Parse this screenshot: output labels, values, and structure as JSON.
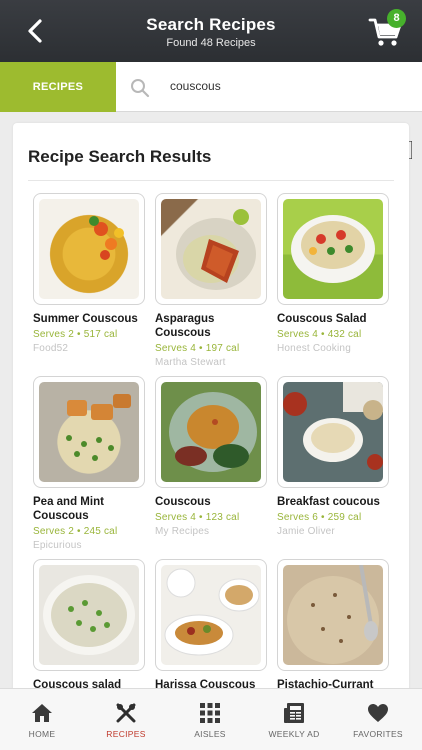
{
  "header": {
    "title": "Search Recipes",
    "subtitle": "Found 48 Recipes",
    "cart_count": "8"
  },
  "search": {
    "tab_label": "RECIPES",
    "query": "couscous"
  },
  "results": {
    "heading": "Recipe Search Results",
    "items": [
      {
        "name": "Summer Couscous",
        "meta": "Serves 2 • 517 cal",
        "source": "Food52"
      },
      {
        "name": "Asparagus Couscous",
        "meta": "Serves 4 • 197 cal",
        "source": "Martha Stewart"
      },
      {
        "name": "Couscous Salad",
        "meta": "Serves 4 • 432 cal",
        "source": "Honest Cooking"
      },
      {
        "name": "Pea and Mint Couscous",
        "meta": "Serves 2 • 245 cal",
        "source": "Epicurious"
      },
      {
        "name": "Couscous",
        "meta": "Serves 4 • 123 cal",
        "source": "My Recipes"
      },
      {
        "name": "Breakfast coucous",
        "meta": "Serves 6 • 259 cal",
        "source": "Jamie Oliver"
      },
      {
        "name": "Couscous salad",
        "meta": "",
        "source": ""
      },
      {
        "name": "Harissa Couscous",
        "meta": "",
        "source": ""
      },
      {
        "name": "Pistachio-Currant",
        "meta": "",
        "source": ""
      }
    ]
  },
  "nav": {
    "items": [
      {
        "label": "HOME",
        "icon": "home-icon"
      },
      {
        "label": "RECIPES",
        "icon": "fork-knife-icon"
      },
      {
        "label": "AISLES",
        "icon": "grid-icon"
      },
      {
        "label": "WEEKLY AD",
        "icon": "newspaper-icon"
      },
      {
        "label": "FAVORITES",
        "icon": "heart-icon"
      }
    ],
    "active": "RECIPES"
  },
  "colors": {
    "accent_green": "#9dbb2f",
    "meta_green": "#99b53a",
    "active_red": "#c0392b",
    "badge_green": "#47b12c"
  }
}
